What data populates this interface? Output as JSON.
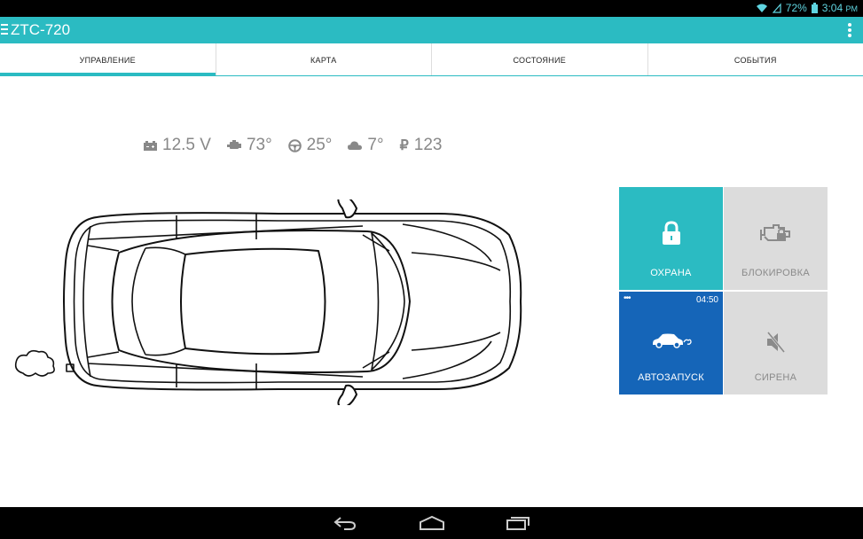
{
  "status_bar": {
    "battery_percent": "72%",
    "time": "3:04",
    "ampm": "PM",
    "icons": [
      "wifi-icon",
      "signal-icon",
      "battery-icon"
    ]
  },
  "app_bar": {
    "title": "ZTC-720",
    "icons": [
      "menu-icon",
      "overflow-icon"
    ]
  },
  "tabs": [
    {
      "label": "УПРАВЛЕНИЕ",
      "active": true
    },
    {
      "label": "КАРТА",
      "active": false
    },
    {
      "label": "СОСТОЯНИЕ",
      "active": false
    },
    {
      "label": "СОБЫТИЯ",
      "active": false
    }
  ],
  "stats": {
    "voltage": "12.5 V",
    "engine_temp": "73°",
    "cabin_temp": "25°",
    "outside_temp": "7°",
    "balance": "123",
    "icons": [
      "battery-icon",
      "engine-icon",
      "steering-wheel-icon",
      "cloud-icon",
      "ruble-icon"
    ],
    "ruble_sign": "₽"
  },
  "tiles": {
    "guard": {
      "label": "ОХРАНА",
      "icon": "lock-icon",
      "color": "#2bbbc2"
    },
    "block": {
      "label": "БЛОКИРОВКА",
      "icon": "engine-lock-icon",
      "color": "#dcdcdc"
    },
    "autostart": {
      "label": "АВТОЗАПУСК",
      "icon": "car-exhaust-icon",
      "timer": "04:50",
      "dots": "•••",
      "color": "#1565b8"
    },
    "siren": {
      "label": "СИРЕНА",
      "icon": "siren-muted-icon",
      "color": "#dcdcdc"
    }
  },
  "colors": {
    "accent": "#2bbbc2",
    "autostart_blue": "#1565b8"
  }
}
